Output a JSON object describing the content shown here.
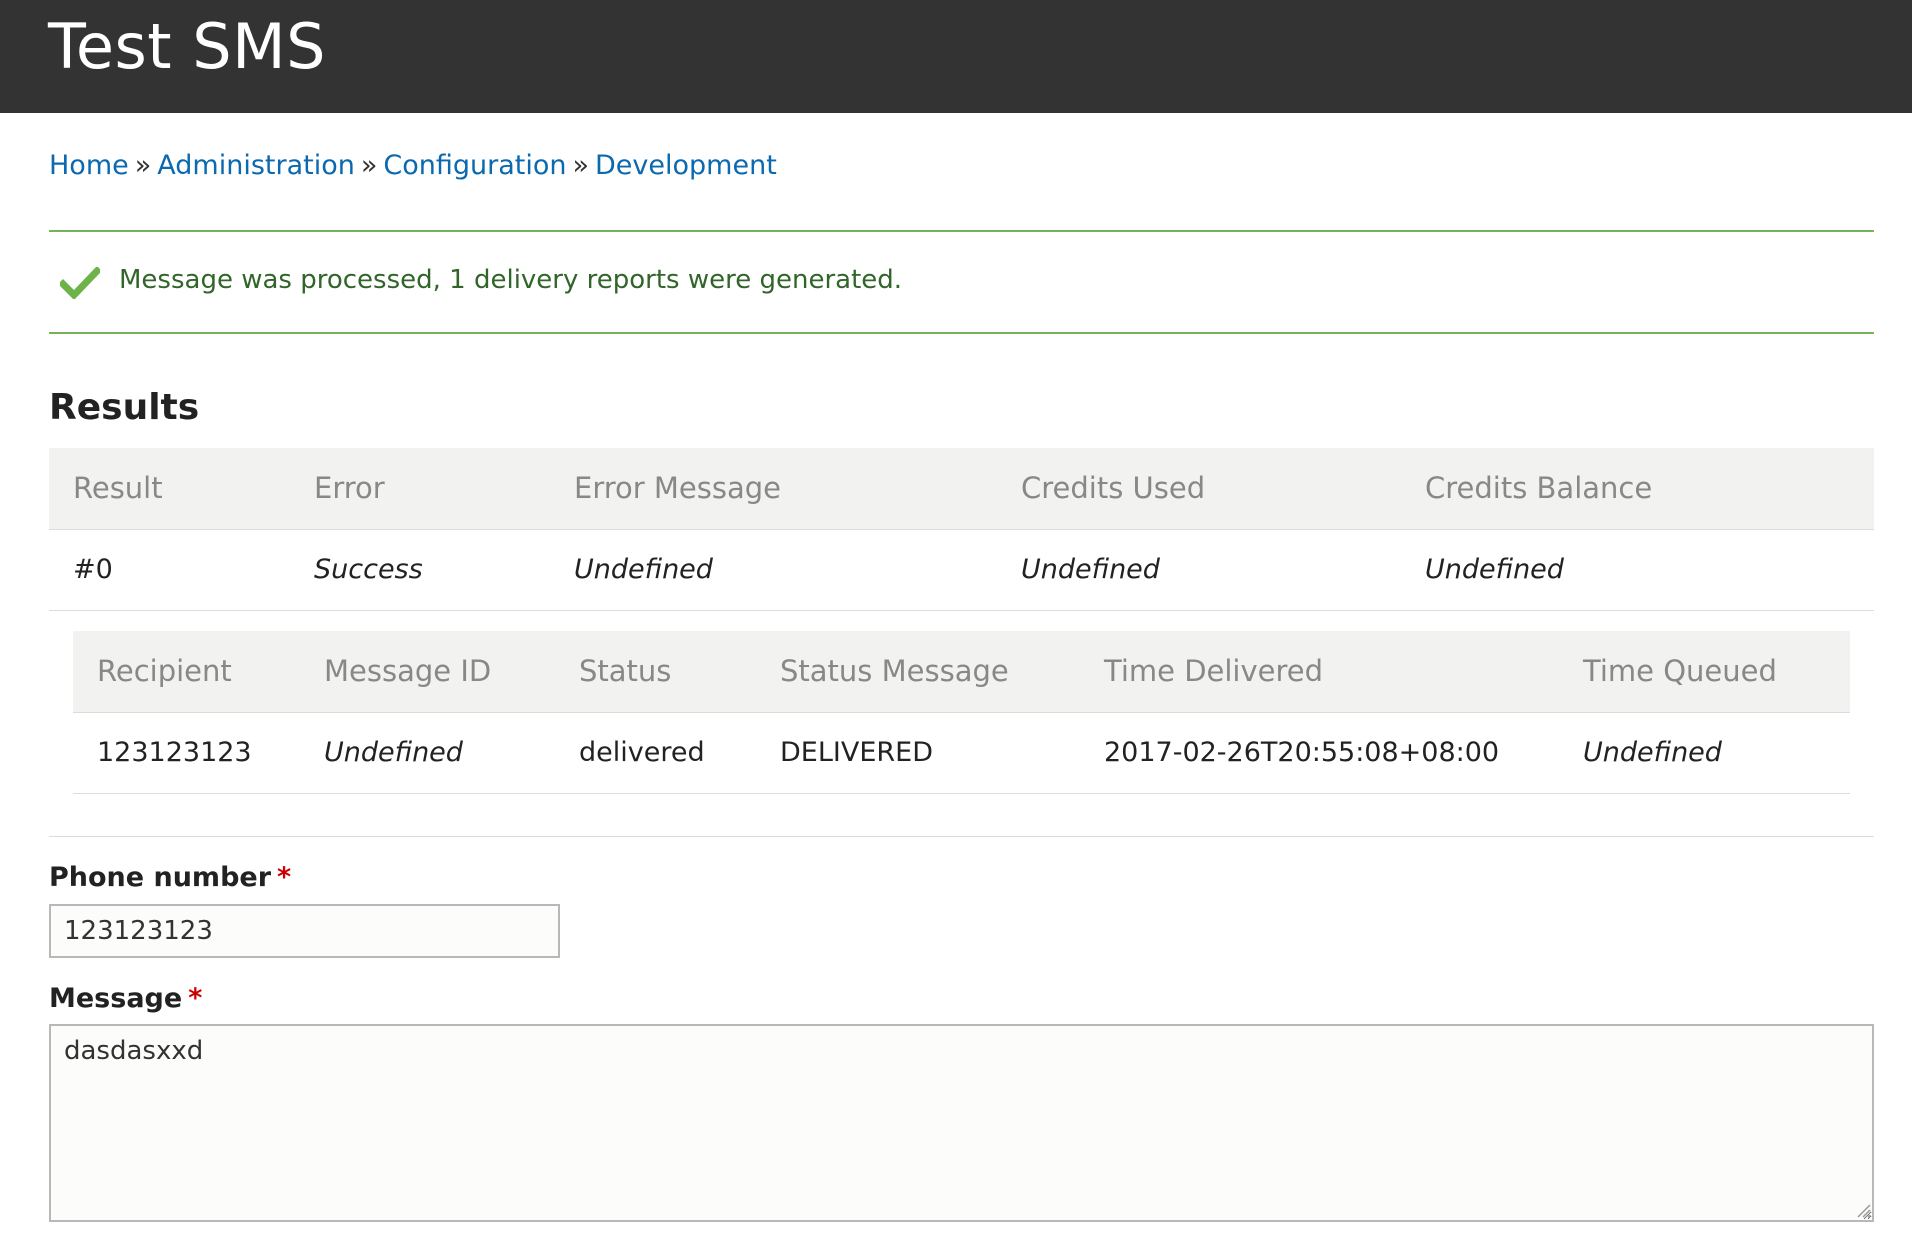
{
  "header": {
    "title": "Test SMS"
  },
  "breadcrumb": {
    "items": [
      "Home",
      "Administration",
      "Configuration",
      "Development"
    ],
    "separator": "»"
  },
  "status": {
    "icon": "checkmark-icon",
    "message": "Message was processed, 1 delivery reports were generated.",
    "color": "#32652a",
    "border_color": "#77b259"
  },
  "results": {
    "heading": "Results",
    "columns": [
      "Result",
      "Error",
      "Error Message",
      "Credits Used",
      "Credits Balance"
    ],
    "rows": [
      [
        "#0",
        "Success",
        "Undefined",
        "Undefined",
        "Undefined"
      ]
    ]
  },
  "deliveries": {
    "columns": [
      "Recipient",
      "Message ID",
      "Status",
      "Status Message",
      "Time Delivered",
      "Time Queued"
    ],
    "rows": [
      [
        "123123123",
        "Undefined",
        "delivered",
        "DELIVERED",
        "2017-02-26T20:55:08+08:00",
        "Undefined"
      ]
    ]
  },
  "form": {
    "phone_label": "Phone number",
    "phone_value": "123123123",
    "message_label": "Message",
    "message_value": "dasdasxxd",
    "required_marker": "*"
  }
}
